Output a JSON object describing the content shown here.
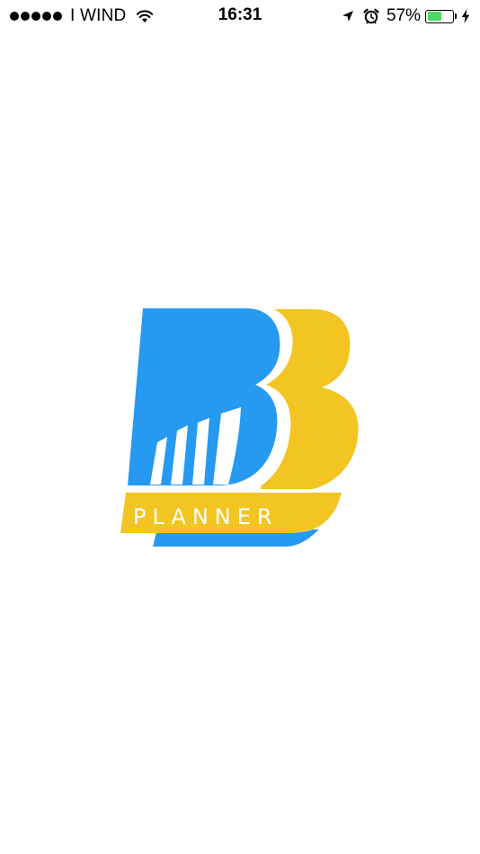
{
  "status_bar": {
    "carrier": "I WIND",
    "time": "16:31",
    "battery_percent": "57%",
    "battery_level": 0.57,
    "icons": [
      "signal-dots-icon",
      "wifi-icon",
      "location-arrow-icon",
      "alarm-clock-icon",
      "battery-icon",
      "charging-bolt-icon"
    ]
  },
  "splash": {
    "logo_text": "PLANNER",
    "colors": {
      "blue": "#2699f1",
      "yellow": "#f2c523",
      "background": "#ffffff"
    }
  }
}
